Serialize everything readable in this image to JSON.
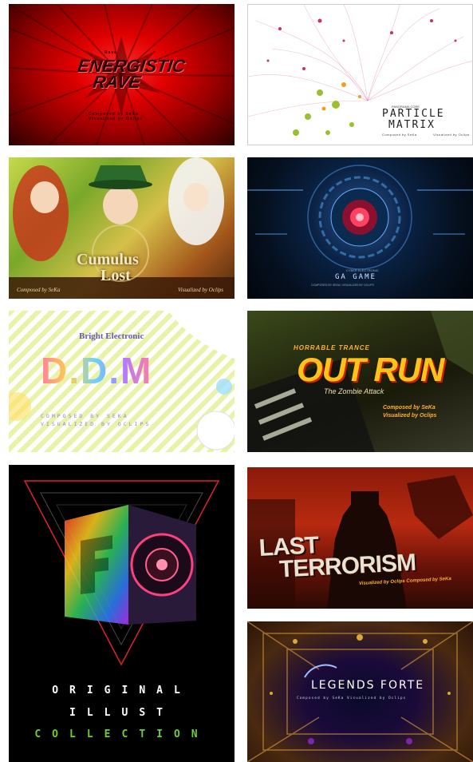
{
  "tiles": [
    {
      "id": "energistic-rave",
      "title_line1": "ENERGISTIC",
      "title_line2": "RAVE",
      "pre": "Rave",
      "sub_line1": "Composed by SeKa",
      "sub_line2": "Visualized by Oclips"
    },
    {
      "id": "particle-matrix",
      "brand": "PANORAMA CORE",
      "title_line1": "PARTICLE",
      "title_line2": "MATRIX",
      "sub1": "Composed by SeKa",
      "sub2": "Visualized by Oclips"
    },
    {
      "id": "cumulus-lost",
      "title_line1": "Cumulus",
      "title_line2": "Lost",
      "sub1": "Composed by SeKa",
      "sub2": "Visualized by Oclips"
    },
    {
      "id": "ga-game",
      "pre": "CYBER ELECTRONIC",
      "title": "GA GAME",
      "sub": "COMPOSED BY SEKA / VISUALIZED BY OCLIPS"
    },
    {
      "id": "ddm",
      "pre": "Bright Electronic",
      "title": "D.D.M",
      "sub1": "COMPOSED BY SEKA",
      "sub2": "VISUALIZED BY OCLIPS"
    },
    {
      "id": "out-run",
      "pre": "HORRABLE TRANCE",
      "title": "OUT RUN",
      "sub": "The Zombie Attack",
      "credit1": "Composed by SeKa",
      "credit2": "Visualized by Oclips"
    },
    {
      "id": "original-illust-collection",
      "line1": "ORIGINAL",
      "line2": "ILLUST",
      "line3": "COLLECTION"
    },
    {
      "id": "last-terrorism",
      "title_line1": "LAST",
      "title_line2": "TERRORISM",
      "sub": "Visualized by Oclips  Composed by SeKa"
    },
    {
      "id": "legends-forte",
      "title": "LEGENDS FORTE",
      "sub": "Composed by SeKa     Visualized by Oclips"
    }
  ]
}
